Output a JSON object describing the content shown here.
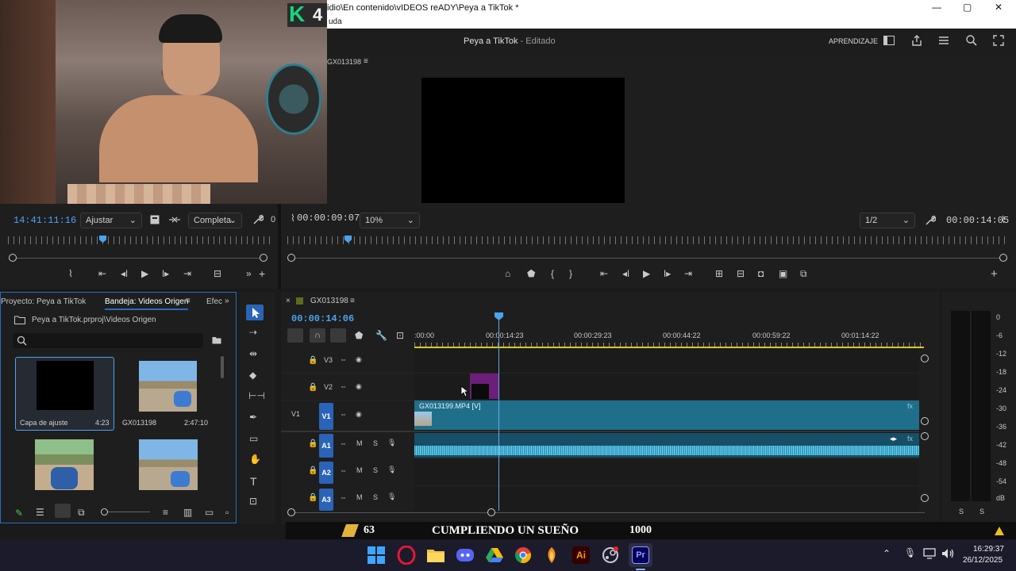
{
  "window": {
    "title_path": "idio\\En contenido\\vIDEOS reADY\\Peya a TikTok *",
    "menu_fragment": "uda",
    "controls": {
      "minimize": "—",
      "maximize": "▢",
      "close": "✕"
    }
  },
  "app_header": {
    "project_title": "Peya a TikTok",
    "edited_suffix": "- Editado",
    "learning_label": "APRENDIZAJE"
  },
  "webcam_badge": {
    "letter": "K",
    "number": "4"
  },
  "source_monitor": {
    "timecode": "14:41:11:16",
    "fit_dropdown": "Ajustar",
    "quality_dropdown": "Completa",
    "trailing": "0"
  },
  "program_monitor": {
    "sequence_name": "GX013198",
    "timecode_in": "00:00:09:07",
    "zoom_dropdown": "10%",
    "resolution_dropdown": "1/2",
    "timecode_out": "00:00:14:05"
  },
  "project_panel": {
    "tab_project": "Proyecto: Peya a TikTok",
    "tab_bin": "Bandeja: Videos Origen",
    "tab_effects": "Efec",
    "path": "Peya a TikTok.prproj\\Videos Origen",
    "search_placeholder": "",
    "items": [
      {
        "name": "Capa de ajuste",
        "duration": "4:23"
      },
      {
        "name": "GX013198",
        "duration": "2:47:10"
      },
      {
        "name": "",
        "duration": ""
      },
      {
        "name": "",
        "duration": ""
      }
    ]
  },
  "timeline": {
    "sequence_name": "GX013198",
    "playhead_timecode": "00:00:14:06",
    "ruler_labels": [
      ":00:00",
      "00:00:14:23",
      "00:00:29:23",
      "00:00:44:22",
      "00:00:59:22",
      "00:01:14:22"
    ],
    "video_tracks": [
      {
        "id": "V3",
        "source": ""
      },
      {
        "id": "V2",
        "source": ""
      },
      {
        "id": "V1",
        "source": "V1"
      }
    ],
    "audio_tracks": [
      {
        "id": "A1",
        "m": "M",
        "s": "S"
      },
      {
        "id": "A2",
        "m": "M",
        "s": "S"
      },
      {
        "id": "A3",
        "m": "M",
        "s": "S"
      }
    ],
    "clip_label": "GX013199.MP4 [V]"
  },
  "audio_meter": {
    "scale": [
      "0",
      "-6",
      "-12",
      "-18",
      "-24",
      "-30",
      "-36",
      "-42",
      "-48",
      "-54",
      "dB"
    ],
    "solo_labels": [
      "S",
      "S"
    ]
  },
  "banner": {
    "left_number": "63",
    "title": "CUMPLIENDO UN SUEÑO",
    "right_number": "1000"
  },
  "taskbar": {
    "time": "16:29:37",
    "date": "26/12/2025",
    "pinned_icons": [
      "windows-icon",
      "opera-icon",
      "file-explorer-icon",
      "discord-icon",
      "google-drive-icon",
      "chrome-icon",
      "fl-studio-icon",
      "illustrator-icon",
      "steam-icon",
      "premiere-icon"
    ]
  },
  "colors": {
    "accent_blue": "#2a64b8",
    "timecode_blue": "#4aa3f0",
    "clip_teal": "#1f6f8b",
    "audio_clip": "#1c8aa8",
    "adjustment_purple": "#6b1f7a"
  }
}
